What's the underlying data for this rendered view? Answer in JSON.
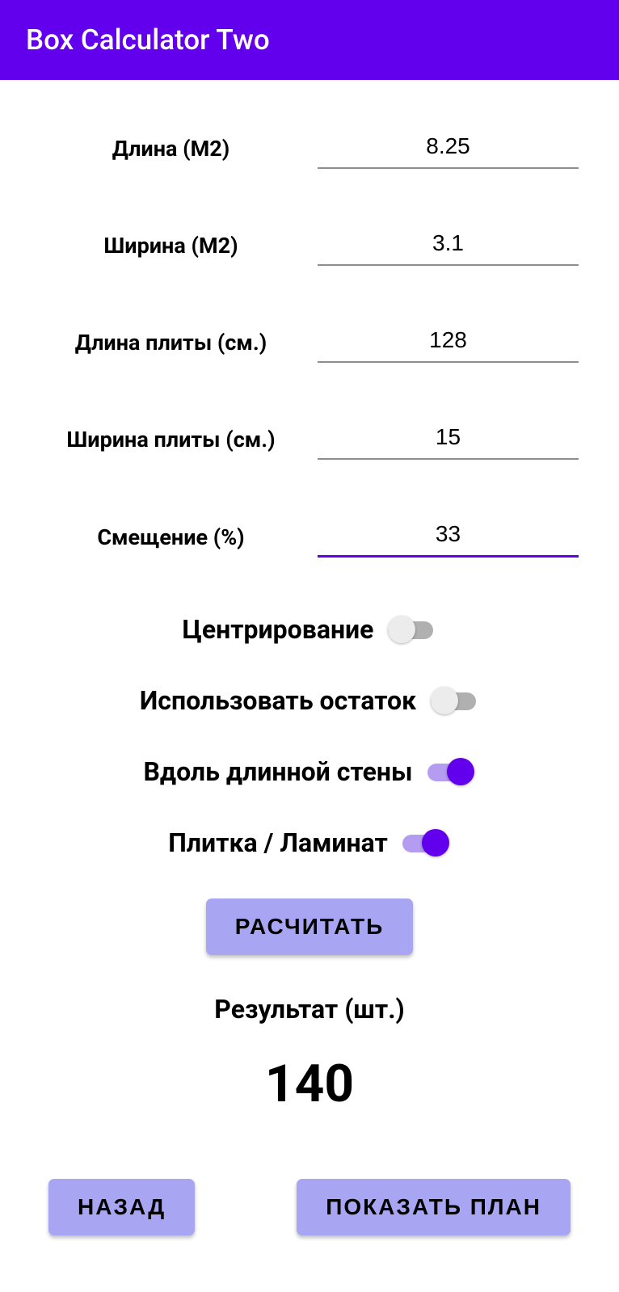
{
  "appbar": {
    "title": "Box Calculator Two"
  },
  "fields": {
    "length": {
      "label": "Длина (М2)",
      "value": "8.25"
    },
    "width": {
      "label": "Ширина (М2)",
      "value": "3.1"
    },
    "tile_length": {
      "label": "Длина плиты (см.)",
      "value": "128"
    },
    "tile_width": {
      "label": "Ширина плиты (см.)",
      "value": "15"
    },
    "offset": {
      "label": "Смещение (%)",
      "value": "33"
    }
  },
  "toggles": {
    "centering": {
      "label": "Центрирование",
      "on": false
    },
    "use_remainder": {
      "label": "Использовать остаток",
      "on": false
    },
    "along_long_wall": {
      "label": "Вдоль длинной стены",
      "on": true
    },
    "tile_laminate": {
      "label": "Плитка / Ламинат",
      "on": true
    }
  },
  "buttons": {
    "calculate": "РАСЧИТАТЬ",
    "back": "НАЗАД",
    "show_plan": "ПОКАЗАТЬ ПЛАН"
  },
  "result": {
    "label": "Результат (шт.)",
    "value": "140"
  }
}
